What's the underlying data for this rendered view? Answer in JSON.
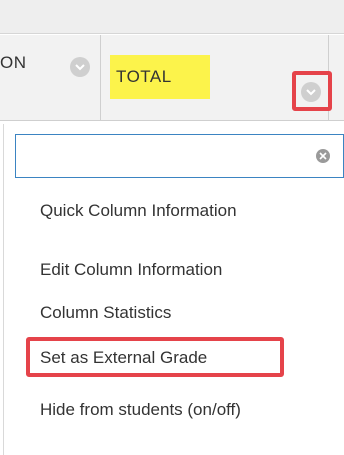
{
  "grade_center": {
    "partial_column_label": "ON",
    "total_column_label": "TOTAL",
    "highlight_color": "#fcf34b",
    "callout_color": "#e5434a"
  },
  "dropdown": {
    "search_value": "",
    "clear_icon": "clear-icon",
    "items": [
      {
        "label": "Quick Column Information"
      },
      {
        "label": "Edit Column Information"
      },
      {
        "label": "Column Statistics"
      },
      {
        "label": "Set as External Grade",
        "highlighted": true
      },
      {
        "label": "Hide from students (on/off)"
      }
    ]
  }
}
